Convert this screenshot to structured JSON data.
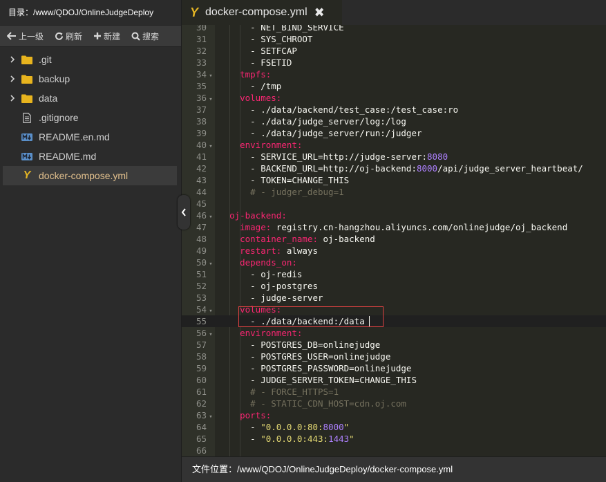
{
  "sidebar": {
    "title": "目录：/www/QDOJ/OnlineJudgeDeploy",
    "toolbar": {
      "up_label": "上一级",
      "refresh_label": "刷新",
      "new_label": "新建",
      "search_label": "搜索"
    },
    "items": [
      {
        "label": ".git",
        "type": "folder"
      },
      {
        "label": "backup",
        "type": "folder"
      },
      {
        "label": "data",
        "type": "folder"
      },
      {
        "label": ".gitignore",
        "type": "file"
      },
      {
        "label": "README.en.md",
        "type": "markdown"
      },
      {
        "label": "README.md",
        "type": "markdown"
      },
      {
        "label": "docker-compose.yml",
        "type": "yaml",
        "active": true
      }
    ]
  },
  "tab": {
    "icon": "Y",
    "label": "docker-compose.yml",
    "close": "✖"
  },
  "editor": {
    "current_line": 55,
    "lines": [
      {
        "n": "30",
        "t": "      - NET_BIND_SERVICE"
      },
      {
        "n": "31",
        "t": "      - SYS_CHROOT"
      },
      {
        "n": "32",
        "t": "      - SETFCAP"
      },
      {
        "n": "33",
        "t": "      - FSETID"
      },
      {
        "n": "34",
        "t": "    tmpfs:"
      },
      {
        "n": "35",
        "t": "      - /tmp"
      },
      {
        "n": "36",
        "t": "    volumes:"
      },
      {
        "n": "37",
        "t": "      - ./data/backend/test_case:/test_case:ro"
      },
      {
        "n": "38",
        "t": "      - ./data/judge_server/log:/log"
      },
      {
        "n": "39",
        "t": "      - ./data/judge_server/run:/judger"
      },
      {
        "n": "40",
        "t": "    environment:"
      },
      {
        "n": "41",
        "t": "      - SERVICE_URL=http://judge-server:8080"
      },
      {
        "n": "42",
        "t": "      - BACKEND_URL=http://oj-backend:8000/api/judge_server_heartbeat/"
      },
      {
        "n": "43",
        "t": "      - TOKEN=CHANGE_THIS"
      },
      {
        "n": "44",
        "t": "      # - judger_debug=1"
      },
      {
        "n": "45",
        "t": ""
      },
      {
        "n": "46",
        "t": "  oj-backend:"
      },
      {
        "n": "47",
        "t": "    image: registry.cn-hangzhou.aliyuncs.com/onlinejudge/oj_backend"
      },
      {
        "n": "48",
        "t": "    container_name: oj-backend"
      },
      {
        "n": "49",
        "t": "    restart: always"
      },
      {
        "n": "50",
        "t": "    depends_on:"
      },
      {
        "n": "51",
        "t": "      - oj-redis"
      },
      {
        "n": "52",
        "t": "      - oj-postgres"
      },
      {
        "n": "53",
        "t": "      - judge-server"
      },
      {
        "n": "54",
        "t": "    volumes:"
      },
      {
        "n": "55",
        "t": "      - ./data/backend:/data"
      },
      {
        "n": "56",
        "t": "    environment:"
      },
      {
        "n": "57",
        "t": "      - POSTGRES_DB=onlinejudge"
      },
      {
        "n": "58",
        "t": "      - POSTGRES_USER=onlinejudge"
      },
      {
        "n": "59",
        "t": "      - POSTGRES_PASSWORD=onlinejudge"
      },
      {
        "n": "60",
        "t": "      - JUDGE_SERVER_TOKEN=CHANGE_THIS"
      },
      {
        "n": "61",
        "t": "      # - FORCE_HTTPS=1"
      },
      {
        "n": "62",
        "t": "      # - STATIC_CDN_HOST=cdn.oj.com"
      },
      {
        "n": "63",
        "t": "    ports:"
      },
      {
        "n": "64",
        "t": "      - \"0.0.0.0:80:8000\""
      },
      {
        "n": "65",
        "t": "      - \"0.0.0.0:443:1443\""
      },
      {
        "n": "66",
        "t": ""
      }
    ],
    "fold_lines": [
      "34",
      "36",
      "40",
      "46",
      "50",
      "54",
      "56",
      "63"
    ]
  },
  "status": {
    "file_location": "文件位置：/www/QDOJ/OnlineJudgeDeploy/docker-compose.yml"
  },
  "colors": {
    "keyword": "#f92672",
    "string": "#e6db74",
    "number": "#ae81ff",
    "comment": "#75715e",
    "folder": "#e8b41e",
    "markdown_icon": "#5a8fc9",
    "highlight_box": "#e04242"
  }
}
